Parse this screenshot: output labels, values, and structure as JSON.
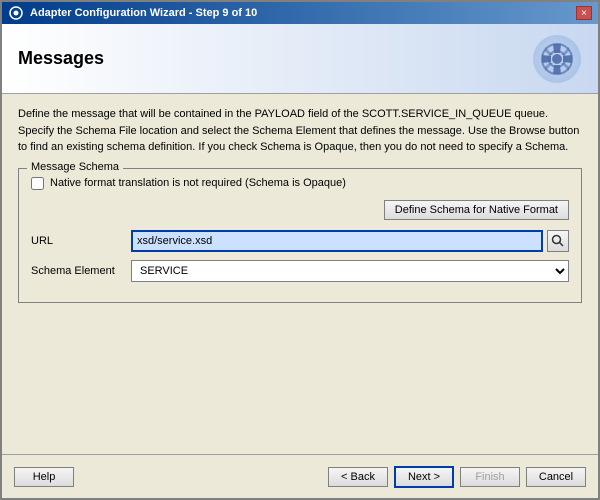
{
  "titleBar": {
    "title": "Adapter Configuration Wizard - Step 9 of 10",
    "closeLabel": "×"
  },
  "header": {
    "title": "Messages"
  },
  "description": "Define the message that will be contained in the PAYLOAD field of the SCOTT.SERVICE_IN_QUEUE queue.  Specify the Schema File location and select the Schema Element that defines the message. Use the Browse button to find an existing schema definition. If you check Schema is Opaque, then you do not need to specify a Schema.",
  "messageSchema": {
    "groupLabel": "Message Schema",
    "checkbox": {
      "label": "Native format translation is not required (Schema is Opaque)",
      "checked": false
    },
    "defineSchemaButton": "Define Schema for Native Format",
    "urlLabel": "URL",
    "urlValue": "xsd/service.xsd",
    "schemaElementLabel": "Schema Element",
    "schemaElementValue": "SERVICE",
    "schemaElementOptions": [
      "SERVICE"
    ]
  },
  "footer": {
    "helpLabel": "Help",
    "backLabel": "< Back",
    "nextLabel": "Next >",
    "finishLabel": "Finish",
    "cancelLabel": "Cancel"
  }
}
